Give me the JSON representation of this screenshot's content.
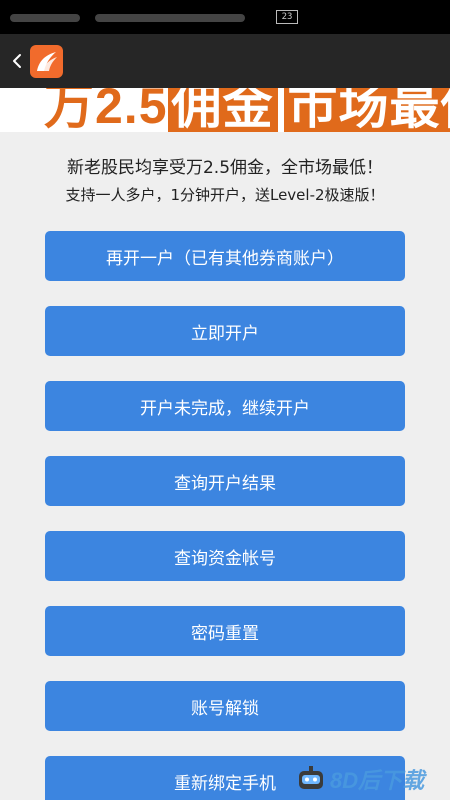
{
  "status_bar": {
    "badge": "23"
  },
  "app_bar": {
    "back_icon": "chevron-left-icon",
    "logo": "app-logo-icon",
    "accent": "#f16b2c"
  },
  "banner": {
    "part1": "万2.5",
    "part2": "佣金",
    "part3": "市场最低"
  },
  "intro": {
    "line1": "新老股民均享受万2.5佣金，全市场最低！",
    "line2": "支持一人多户，1分钟开户，送Level-2极速版！"
  },
  "buttons": [
    {
      "label": "再开一户（已有其他券商账户）"
    },
    {
      "label": "立即开户"
    },
    {
      "label": "开户未完成，继续开户"
    },
    {
      "label": "查询开户结果"
    },
    {
      "label": "查询资金帐号"
    },
    {
      "label": "密码重置"
    },
    {
      "label": "账号解锁"
    },
    {
      "label": "重新绑定手机"
    }
  ],
  "colors": {
    "button": "#3c85e0",
    "background": "#efefef",
    "banner_accent": "#e06a1b"
  },
  "watermark": {
    "text": "8D后下载"
  }
}
